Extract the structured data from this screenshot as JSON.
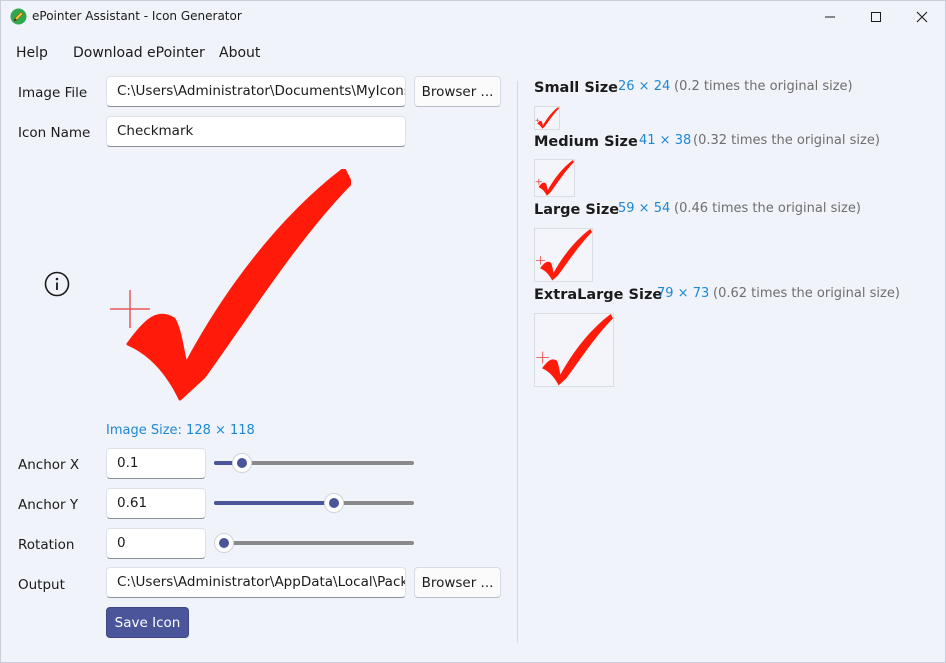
{
  "window": {
    "title": "ePointer Assistant - Icon Generator"
  },
  "menu": {
    "items": [
      "Help",
      "Download ePointer",
      "About"
    ]
  },
  "form": {
    "image_file_label": "Image File",
    "image_file_value": "C:\\Users\\Administrator\\Documents\\MyIcons",
    "browse_label": "Browser ...",
    "icon_name_label": "Icon Name",
    "icon_name_value": "Checkmark",
    "image_size_text": "Image Size: 128 × 118",
    "anchor_x_label": "Anchor X",
    "anchor_x_value": "0.1",
    "anchor_x_slider": 0.1,
    "anchor_y_label": "Anchor Y",
    "anchor_y_value": "0.61",
    "anchor_y_slider": 0.61,
    "rotation_label": "Rotation",
    "rotation_value": "0",
    "rotation_slider": 0,
    "output_label": "Output",
    "output_value": "C:\\Users\\Administrator\\AppData\\Local\\Pack",
    "output_browse_label": "Browser ...",
    "save_label": "Save Icon"
  },
  "previews": [
    {
      "title": "Small Size",
      "dims": "26 × 24",
      "ratio": "(0.2 times the original size)"
    },
    {
      "title": "Medium Size",
      "dims": "41 × 38",
      "ratio": "(0.32 times the original size)"
    },
    {
      "title": "Large Size",
      "dims": "59 × 54",
      "ratio": "(0.46 times the original size)"
    },
    {
      "title": "ExtraLarge Size",
      "dims": "79 × 73",
      "ratio": "(0.62 times the original size)"
    }
  ],
  "icons": {
    "app": "pencil-app-icon",
    "info": "info-icon",
    "image": "checkmark-icon",
    "anchor": "crosshair-icon"
  },
  "colors": {
    "accent": "#4a559a",
    "link": "#1e88d4",
    "check": "#ff1a0a",
    "crosshair": "#e85a5a"
  }
}
